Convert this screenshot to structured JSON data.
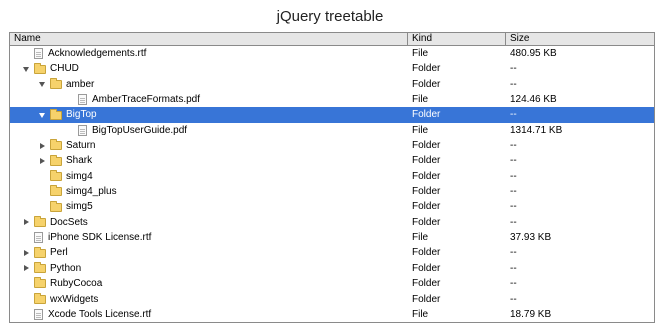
{
  "title": "jQuery treetable",
  "columns": {
    "name": "Name",
    "kind": "Kind",
    "size": "Size"
  },
  "rows": [
    {
      "name": "Acknowledgements.rtf",
      "kind": "File",
      "size": "480.95 KB",
      "depth": 0,
      "type": "file",
      "toggle": "none",
      "selected": false
    },
    {
      "name": "CHUD",
      "kind": "Folder",
      "size": "--",
      "depth": 0,
      "type": "folder",
      "toggle": "open",
      "selected": false
    },
    {
      "name": "amber",
      "kind": "Folder",
      "size": "--",
      "depth": 1,
      "type": "folder",
      "toggle": "open",
      "selected": false
    },
    {
      "name": "AmberTraceFormats.pdf",
      "kind": "File",
      "size": "124.46 KB",
      "depth": 2,
      "type": "file",
      "toggle": "none",
      "selected": false
    },
    {
      "name": "BigTop",
      "kind": "Folder",
      "size": "--",
      "depth": 1,
      "type": "folder",
      "toggle": "open",
      "selected": true
    },
    {
      "name": "BigTopUserGuide.pdf",
      "kind": "File",
      "size": "1314.71 KB",
      "depth": 2,
      "type": "file",
      "toggle": "none",
      "selected": false
    },
    {
      "name": "Saturn",
      "kind": "Folder",
      "size": "--",
      "depth": 1,
      "type": "folder",
      "toggle": "closed",
      "selected": false
    },
    {
      "name": "Shark",
      "kind": "Folder",
      "size": "--",
      "depth": 1,
      "type": "folder",
      "toggle": "closed",
      "selected": false
    },
    {
      "name": "simg4",
      "kind": "Folder",
      "size": "--",
      "depth": 1,
      "type": "folder",
      "toggle": "none",
      "selected": false
    },
    {
      "name": "simg4_plus",
      "kind": "Folder",
      "size": "--",
      "depth": 1,
      "type": "folder",
      "toggle": "none",
      "selected": false
    },
    {
      "name": "simg5",
      "kind": "Folder",
      "size": "--",
      "depth": 1,
      "type": "folder",
      "toggle": "none",
      "selected": false
    },
    {
      "name": "DocSets",
      "kind": "Folder",
      "size": "--",
      "depth": 0,
      "type": "folder",
      "toggle": "closed",
      "selected": false
    },
    {
      "name": "iPhone SDK License.rtf",
      "kind": "File",
      "size": "37.93 KB",
      "depth": 0,
      "type": "file",
      "toggle": "none",
      "selected": false
    },
    {
      "name": "Perl",
      "kind": "Folder",
      "size": "--",
      "depth": 0,
      "type": "folder",
      "toggle": "closed",
      "selected": false
    },
    {
      "name": "Python",
      "kind": "Folder",
      "size": "--",
      "depth": 0,
      "type": "folder",
      "toggle": "closed",
      "selected": false
    },
    {
      "name": "RubyCocoa",
      "kind": "Folder",
      "size": "--",
      "depth": 0,
      "type": "folder",
      "toggle": "none",
      "selected": false
    },
    {
      "name": "wxWidgets",
      "kind": "Folder",
      "size": "--",
      "depth": 0,
      "type": "folder",
      "toggle": "none",
      "selected": false
    },
    {
      "name": "Xcode Tools License.rtf",
      "kind": "File",
      "size": "18.79 KB",
      "depth": 0,
      "type": "file",
      "toggle": "none",
      "selected": false
    }
  ],
  "colors": {
    "selected_row": "#3875d7",
    "header_bg": "#e6e6e6",
    "border": "#8a8a8a",
    "folder": "#f6d26b"
  }
}
